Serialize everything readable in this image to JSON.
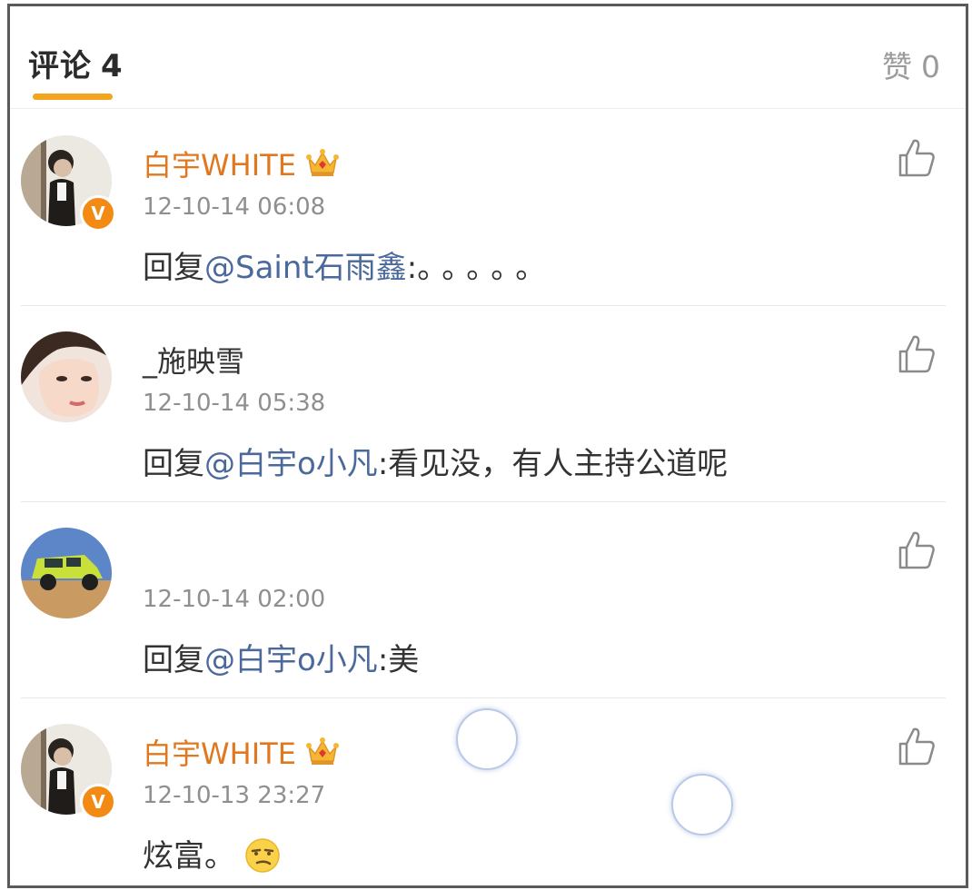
{
  "tabs": {
    "comments_label": "评论",
    "comments_count": "4",
    "likes_label": "赞",
    "likes_count": "0",
    "indicator_color": "#f3a51f"
  },
  "comments": [
    {
      "username": "白宇WHITE",
      "verified": true,
      "badge_icon": "crown-icon",
      "timestamp": "12-10-14 06:08",
      "prefix": "回复",
      "mention": "@Saint石雨鑫",
      "colon": ":",
      "body": "。。。。。"
    },
    {
      "username": "_施映雪",
      "verified": false,
      "timestamp": "12-10-14 05:38",
      "prefix": "回复",
      "mention": "@白宇o小凡",
      "colon": ":",
      "body": "看见没，有人主持公道呢"
    },
    {
      "username": "",
      "verified": false,
      "timestamp": "12-10-14 02:00",
      "prefix": "回复",
      "mention": "@白宇o小凡",
      "colon": ":",
      "body": "美"
    },
    {
      "username": "白宇WHITE",
      "verified": true,
      "badge_icon": "crown-icon",
      "timestamp": "12-10-13 23:27",
      "prefix": "",
      "mention": "",
      "colon": "",
      "body": "炫富。",
      "emoji": "smirk-emoji-icon"
    }
  ],
  "colors": {
    "vip_name": "#e0781f",
    "mention": "#4b6a9b",
    "verified_badge": "#f28a14"
  },
  "verified_badge_letter": "V"
}
